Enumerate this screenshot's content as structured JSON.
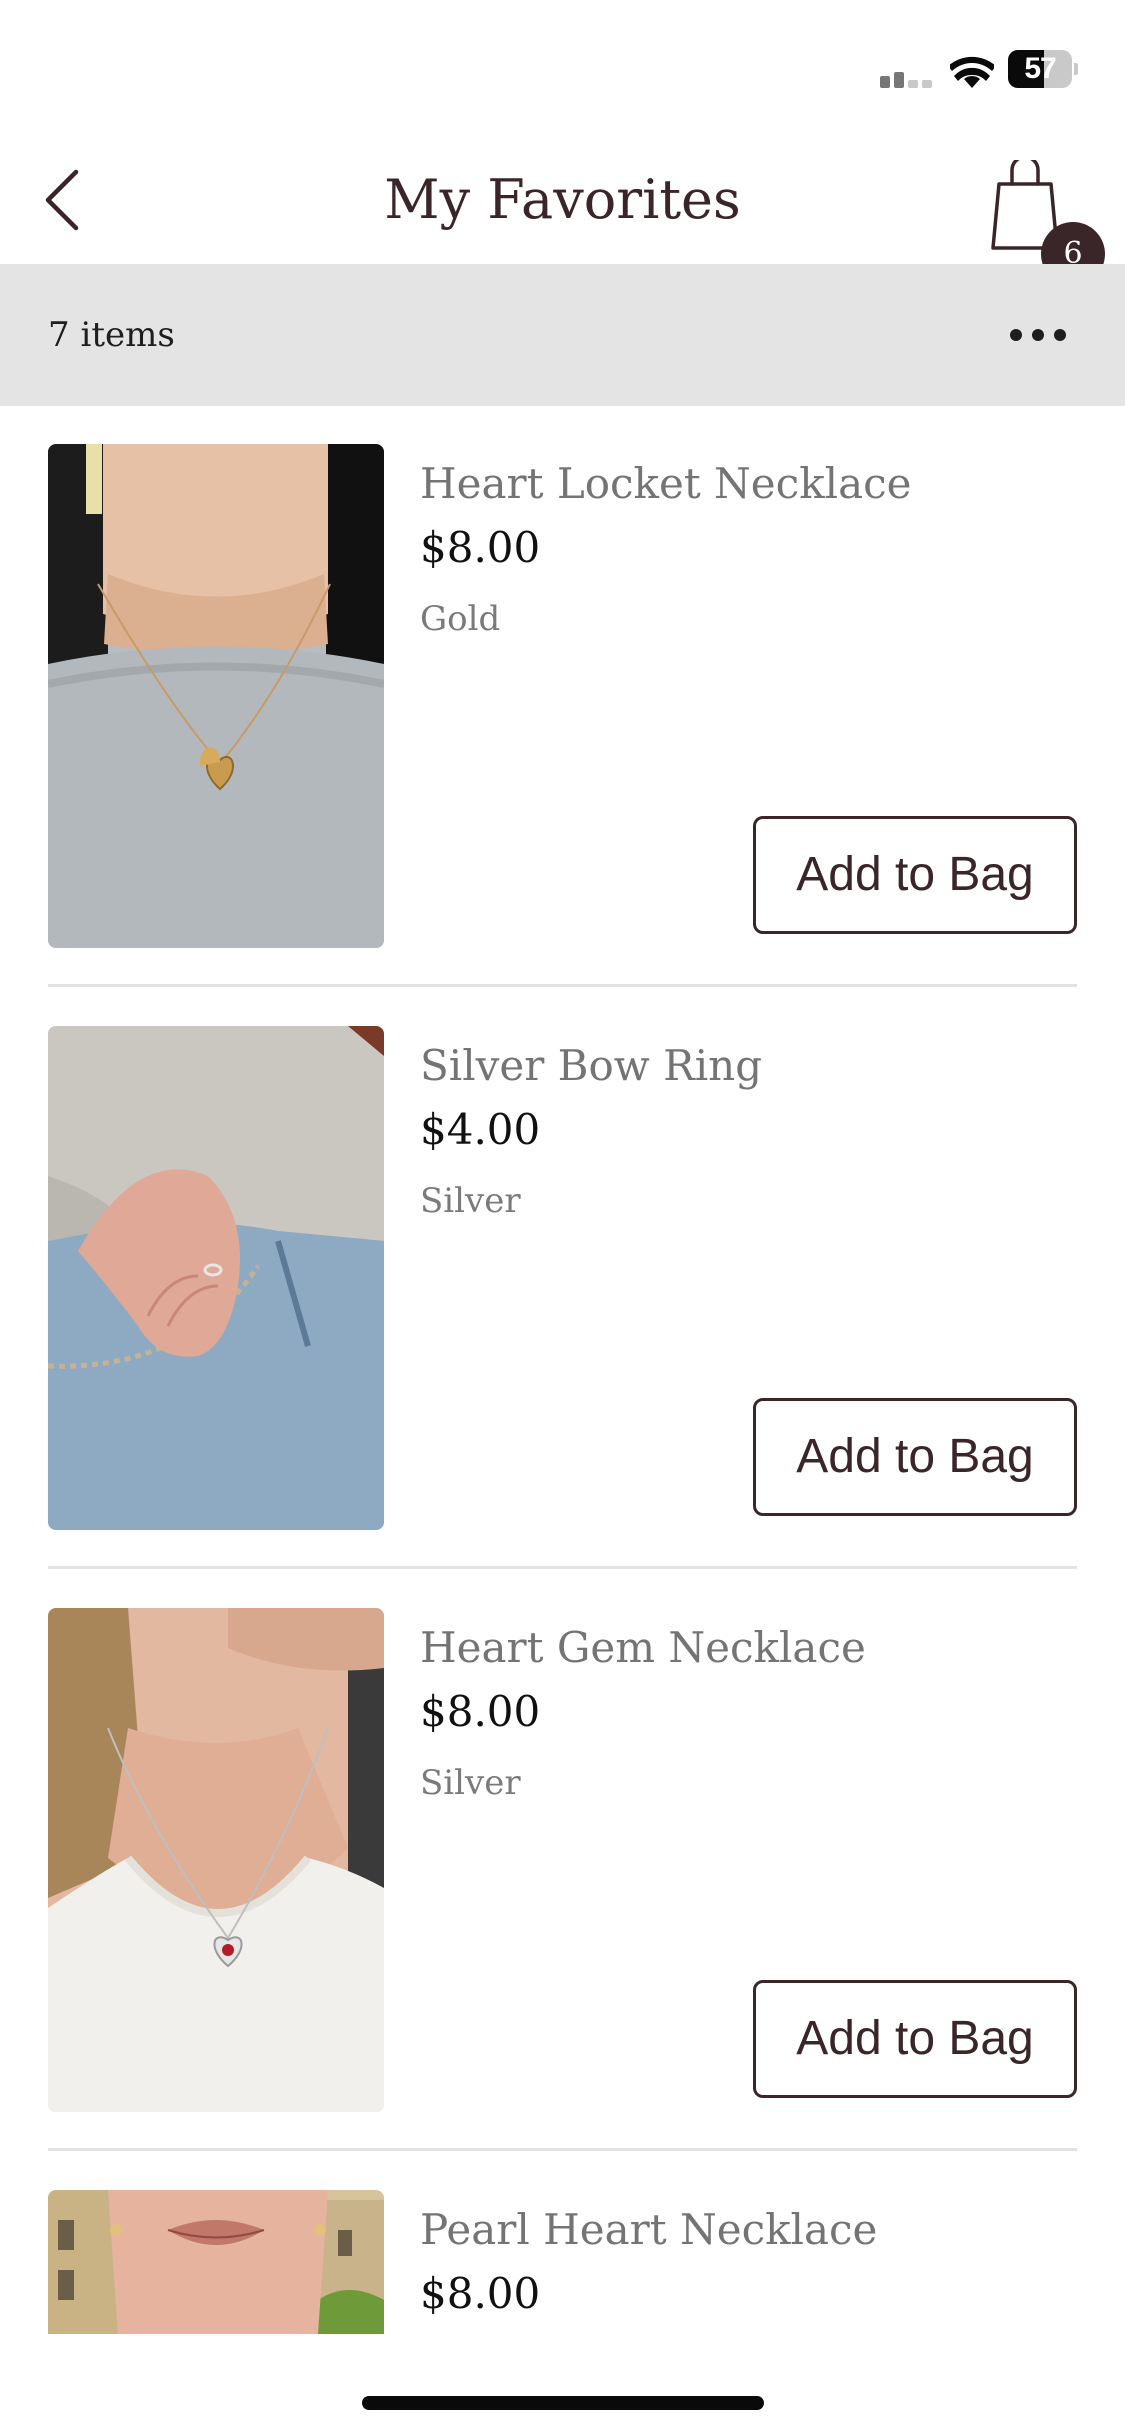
{
  "status_bar": {
    "battery_level": "57",
    "battery_fill_fraction": 0.57,
    "icons": [
      "cellular-signal-icon",
      "wifi-icon",
      "battery-icon"
    ]
  },
  "nav": {
    "title": "My Favorites",
    "back_icon": "chevron-left-icon",
    "bag_icon": "shopping-bag-icon",
    "bag_count": "6"
  },
  "list_header": {
    "items_count": "7 items",
    "more_icon": "ellipsis-icon"
  },
  "products": [
    {
      "name": "Heart Locket Necklace",
      "price": "$8.00",
      "color": "Gold",
      "button_label": "Add to Bag",
      "image": "woman-wearing-gold-heart-locket-necklace"
    },
    {
      "name": "Silver Bow Ring",
      "price": "$4.00",
      "color": "Silver",
      "button_label": "Add to Bag",
      "image": "hand-in-jeans-pocket-wearing-silver-bow-ring"
    },
    {
      "name": "Heart Gem Necklace",
      "price": "$8.00",
      "color": "Silver",
      "button_label": "Add to Bag",
      "image": "woman-wearing-silver-heart-gem-necklace"
    },
    {
      "name": "Pearl Heart Necklace",
      "price": "$8.00",
      "image": "woman-face-crop-pearl-heart-necklace"
    }
  ],
  "colors": {
    "brand": "#3a2528",
    "header_background": "#e4e4e4",
    "secondary_text": "#747474"
  }
}
